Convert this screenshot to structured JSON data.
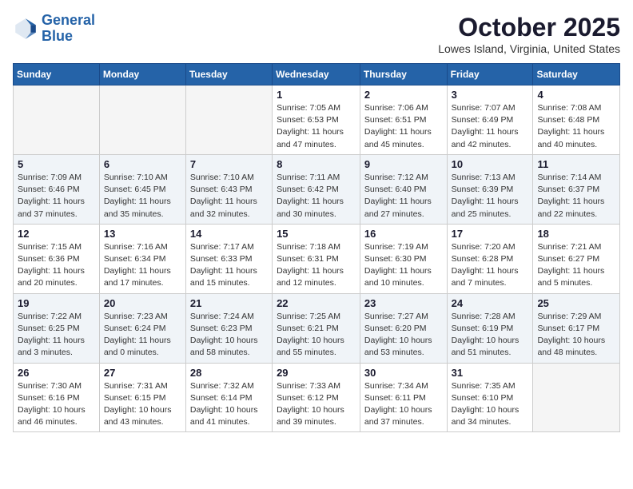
{
  "header": {
    "logo_line1": "General",
    "logo_line2": "Blue",
    "month": "October 2025",
    "location": "Lowes Island, Virginia, United States"
  },
  "days_of_week": [
    "Sunday",
    "Monday",
    "Tuesday",
    "Wednesday",
    "Thursday",
    "Friday",
    "Saturday"
  ],
  "weeks": [
    {
      "shaded": false,
      "days": [
        {
          "num": "",
          "info": ""
        },
        {
          "num": "",
          "info": ""
        },
        {
          "num": "",
          "info": ""
        },
        {
          "num": "1",
          "info": "Sunrise: 7:05 AM\nSunset: 6:53 PM\nDaylight: 11 hours\nand 47 minutes."
        },
        {
          "num": "2",
          "info": "Sunrise: 7:06 AM\nSunset: 6:51 PM\nDaylight: 11 hours\nand 45 minutes."
        },
        {
          "num": "3",
          "info": "Sunrise: 7:07 AM\nSunset: 6:49 PM\nDaylight: 11 hours\nand 42 minutes."
        },
        {
          "num": "4",
          "info": "Sunrise: 7:08 AM\nSunset: 6:48 PM\nDaylight: 11 hours\nand 40 minutes."
        }
      ]
    },
    {
      "shaded": true,
      "days": [
        {
          "num": "5",
          "info": "Sunrise: 7:09 AM\nSunset: 6:46 PM\nDaylight: 11 hours\nand 37 minutes."
        },
        {
          "num": "6",
          "info": "Sunrise: 7:10 AM\nSunset: 6:45 PM\nDaylight: 11 hours\nand 35 minutes."
        },
        {
          "num": "7",
          "info": "Sunrise: 7:10 AM\nSunset: 6:43 PM\nDaylight: 11 hours\nand 32 minutes."
        },
        {
          "num": "8",
          "info": "Sunrise: 7:11 AM\nSunset: 6:42 PM\nDaylight: 11 hours\nand 30 minutes."
        },
        {
          "num": "9",
          "info": "Sunrise: 7:12 AM\nSunset: 6:40 PM\nDaylight: 11 hours\nand 27 minutes."
        },
        {
          "num": "10",
          "info": "Sunrise: 7:13 AM\nSunset: 6:39 PM\nDaylight: 11 hours\nand 25 minutes."
        },
        {
          "num": "11",
          "info": "Sunrise: 7:14 AM\nSunset: 6:37 PM\nDaylight: 11 hours\nand 22 minutes."
        }
      ]
    },
    {
      "shaded": false,
      "days": [
        {
          "num": "12",
          "info": "Sunrise: 7:15 AM\nSunset: 6:36 PM\nDaylight: 11 hours\nand 20 minutes."
        },
        {
          "num": "13",
          "info": "Sunrise: 7:16 AM\nSunset: 6:34 PM\nDaylight: 11 hours\nand 17 minutes."
        },
        {
          "num": "14",
          "info": "Sunrise: 7:17 AM\nSunset: 6:33 PM\nDaylight: 11 hours\nand 15 minutes."
        },
        {
          "num": "15",
          "info": "Sunrise: 7:18 AM\nSunset: 6:31 PM\nDaylight: 11 hours\nand 12 minutes."
        },
        {
          "num": "16",
          "info": "Sunrise: 7:19 AM\nSunset: 6:30 PM\nDaylight: 11 hours\nand 10 minutes."
        },
        {
          "num": "17",
          "info": "Sunrise: 7:20 AM\nSunset: 6:28 PM\nDaylight: 11 hours\nand 7 minutes."
        },
        {
          "num": "18",
          "info": "Sunrise: 7:21 AM\nSunset: 6:27 PM\nDaylight: 11 hours\nand 5 minutes."
        }
      ]
    },
    {
      "shaded": true,
      "days": [
        {
          "num": "19",
          "info": "Sunrise: 7:22 AM\nSunset: 6:25 PM\nDaylight: 11 hours\nand 3 minutes."
        },
        {
          "num": "20",
          "info": "Sunrise: 7:23 AM\nSunset: 6:24 PM\nDaylight: 11 hours\nand 0 minutes."
        },
        {
          "num": "21",
          "info": "Sunrise: 7:24 AM\nSunset: 6:23 PM\nDaylight: 10 hours\nand 58 minutes."
        },
        {
          "num": "22",
          "info": "Sunrise: 7:25 AM\nSunset: 6:21 PM\nDaylight: 10 hours\nand 55 minutes."
        },
        {
          "num": "23",
          "info": "Sunrise: 7:27 AM\nSunset: 6:20 PM\nDaylight: 10 hours\nand 53 minutes."
        },
        {
          "num": "24",
          "info": "Sunrise: 7:28 AM\nSunset: 6:19 PM\nDaylight: 10 hours\nand 51 minutes."
        },
        {
          "num": "25",
          "info": "Sunrise: 7:29 AM\nSunset: 6:17 PM\nDaylight: 10 hours\nand 48 minutes."
        }
      ]
    },
    {
      "shaded": false,
      "days": [
        {
          "num": "26",
          "info": "Sunrise: 7:30 AM\nSunset: 6:16 PM\nDaylight: 10 hours\nand 46 minutes."
        },
        {
          "num": "27",
          "info": "Sunrise: 7:31 AM\nSunset: 6:15 PM\nDaylight: 10 hours\nand 43 minutes."
        },
        {
          "num": "28",
          "info": "Sunrise: 7:32 AM\nSunset: 6:14 PM\nDaylight: 10 hours\nand 41 minutes."
        },
        {
          "num": "29",
          "info": "Sunrise: 7:33 AM\nSunset: 6:12 PM\nDaylight: 10 hours\nand 39 minutes."
        },
        {
          "num": "30",
          "info": "Sunrise: 7:34 AM\nSunset: 6:11 PM\nDaylight: 10 hours\nand 37 minutes."
        },
        {
          "num": "31",
          "info": "Sunrise: 7:35 AM\nSunset: 6:10 PM\nDaylight: 10 hours\nand 34 minutes."
        },
        {
          "num": "",
          "info": ""
        }
      ]
    }
  ]
}
